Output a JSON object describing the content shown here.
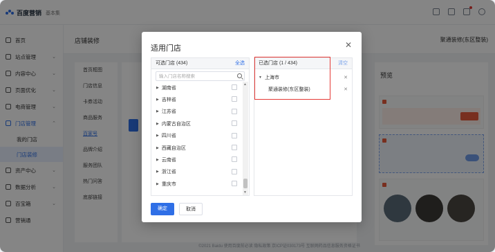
{
  "app": {
    "logo_text": "百度营销",
    "logo_sub": "基本集"
  },
  "sidebar": {
    "items": [
      {
        "label": "首页",
        "icon": "home-icon"
      },
      {
        "label": "站点管理",
        "icon": "site-icon"
      },
      {
        "label": "内容中心",
        "icon": "content-icon"
      },
      {
        "label": "页面优化",
        "icon": "page-icon"
      },
      {
        "label": "电商管理",
        "icon": "shop-icon"
      },
      {
        "label": "门店管理",
        "icon": "store-icon"
      }
    ],
    "sub_items": [
      "我的门店",
      "门店装修"
    ],
    "bottom_items": [
      {
        "label": "资产中心",
        "icon": "asset-icon"
      },
      {
        "label": "数据分析",
        "icon": "chart-icon"
      },
      {
        "label": "百宝箱",
        "icon": "box-icon"
      },
      {
        "label": "营销通",
        "icon": "marketing-icon"
      }
    ]
  },
  "page": {
    "title": "店铺装修",
    "store_switch": "聚通装修(东区整装)"
  },
  "subnav": [
    "首页框图",
    "门店信息",
    "卡券活动",
    "商品服务",
    "百家号",
    "品牌介绍",
    "服务团队",
    "热门问答",
    "底部链接"
  ],
  "preview": {
    "title": "预览"
  },
  "footer": {
    "text": "©2021 Baidu 使用百度前必读 隐私政策 京ICP证030173号 互联网药品信息服务资格证书"
  },
  "modal": {
    "title": "适用门店",
    "available": {
      "header": "可选门店 (434)",
      "select_all": "全选",
      "search_placeholder": "输入门店名称搜索",
      "provinces": [
        "湖南省",
        "吉林省",
        "江苏省",
        "内蒙古自治区",
        "四川省",
        "西藏自治区",
        "云南省",
        "浙江省",
        "重庆市"
      ]
    },
    "selected": {
      "header": "已选门店 (1 / 434)",
      "clear": "清空",
      "city": "上海市",
      "store": "聚通装修(东区整装)"
    },
    "ok_label": "确定",
    "cancel_label": "取消"
  },
  "colors": {
    "primary": "#2f6fe6",
    "highlight_box": "#e53935"
  }
}
